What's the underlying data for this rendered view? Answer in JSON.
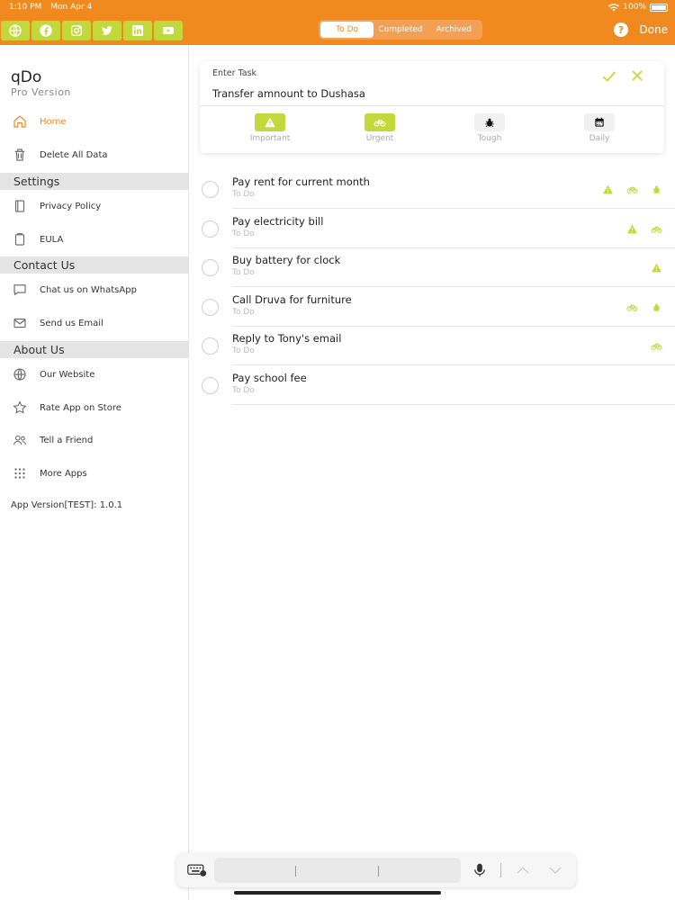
{
  "status": {
    "time": "1:10 PM",
    "date": "Mon Apr 4",
    "battery": "100%"
  },
  "social": [
    "globe-icon",
    "facebook-icon",
    "instagram-icon",
    "twitter-icon",
    "linkedin-icon",
    "youtube-icon"
  ],
  "app": {
    "title": "qDo",
    "subtitle": "Pro Version"
  },
  "menu": {
    "home": "Home",
    "delete_all": "Delete All Data",
    "settings_header": "Settings",
    "privacy": "Privacy Policy",
    "eula": "EULA",
    "contact_header": "Contact Us",
    "whatsapp": "Chat us on WhatsApp",
    "email": "Send us Email",
    "about_header": "About Us",
    "website": "Our Website",
    "rate": "Rate App on Store",
    "tell": "Tell a Friend",
    "more": "More Apps",
    "version": "App Version[TEST]: 1.0.1"
  },
  "topbar": {
    "tabs": [
      "To Do",
      "Completed",
      "Archived"
    ],
    "active_tab": "To Do",
    "help": "?",
    "done": "Done"
  },
  "entry": {
    "label": "Enter Task",
    "value": "Transfer amnount to Dushasa",
    "tags": [
      {
        "label": "Important",
        "icon": "warning-icon",
        "on": true
      },
      {
        "label": "Urgent",
        "icon": "bicycle-icon",
        "on": true
      },
      {
        "label": "Tough",
        "icon": "bug-icon",
        "on": false
      },
      {
        "label": "Daily",
        "icon": "calendar-icon",
        "on": false
      }
    ]
  },
  "tasks": [
    {
      "title": "Pay rent for current month",
      "status": "To Do",
      "icons": [
        "warning-icon",
        "bicycle-icon",
        "bug-icon"
      ]
    },
    {
      "title": "Pay electricity bill",
      "status": "To Do",
      "icons": [
        "warning-icon",
        "bicycle-icon"
      ]
    },
    {
      "title": "Buy battery for clock",
      "status": "To Do",
      "icons": [
        "warning-icon"
      ]
    },
    {
      "title": "Call Druva for furniture",
      "status": "To Do",
      "icons": [
        "bicycle-icon",
        "bug-icon"
      ]
    },
    {
      "title": "Reply to Tony's email",
      "status": "To Do",
      "icons": [
        "bicycle-icon"
      ]
    },
    {
      "title": "Pay school fee",
      "status": "To Do",
      "icons": []
    }
  ],
  "colors": {
    "accent": "#f08a1e",
    "lime": "#c3d83a",
    "active_menu": "#f08a1e"
  }
}
